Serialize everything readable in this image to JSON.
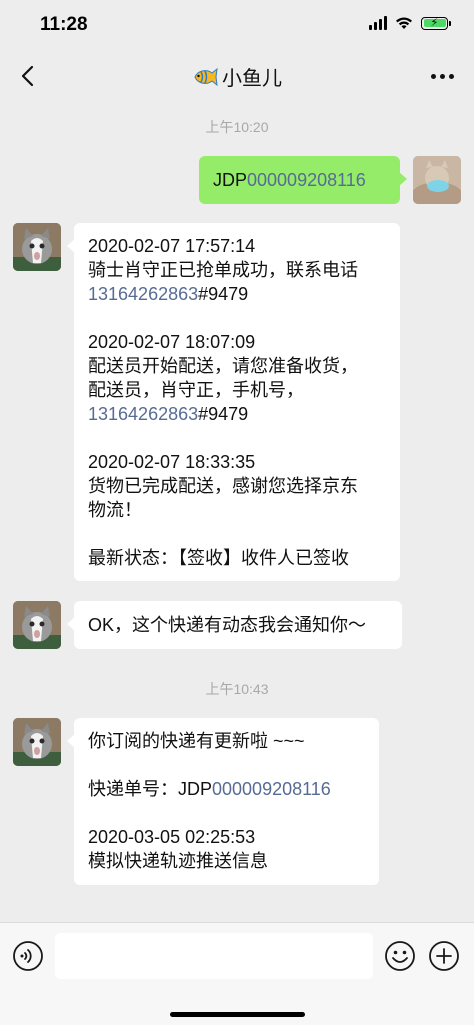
{
  "status_bar": {
    "time": "11:28"
  },
  "nav": {
    "title": "小鱼儿"
  },
  "messages": {
    "ts1": "上午10:20",
    "m1": {
      "prefix": "JDP",
      "number": "000009208116"
    },
    "m2": {
      "l1": "2020-02-07 17:57:14",
      "l2": "骑士肖守正已抢单成功，联系电话",
      "l3_phone": "13164262863",
      "l3_ext": "#9479",
      "l4": "2020-02-07 18:07:09",
      "l5": "配送员开始配送，请您准备收货，",
      "l6": "配送员，肖守正，手机号，",
      "l7_phone": "13164262863",
      "l7_ext": "#9479",
      "l8": "2020-02-07 18:33:35",
      "l9": "货物已完成配送，感谢您选择京东",
      "l10": "物流！",
      "l11": "最新状态：【签收】收件人已签收"
    },
    "m3": "OK，这个快递有动态我会通知你～",
    "ts2": "上午10:43",
    "m4": {
      "l1": "你订阅的快递有更新啦 ~~~",
      "l2_label": "快递单号：JDP",
      "l2_number": "000009208116",
      "l3": "2020-03-05 02:25:53",
      "l4": "模拟快递轨迹推送信息"
    }
  },
  "colors": {
    "background": "#ededed",
    "bubble_self": "#95ec69",
    "bubble_other": "#ffffff",
    "link": "#576b95"
  },
  "icons": [
    "back-icon",
    "fish-emoji-icon",
    "more-icon",
    "voice-icon",
    "emoji-icon",
    "plus-icon"
  ]
}
